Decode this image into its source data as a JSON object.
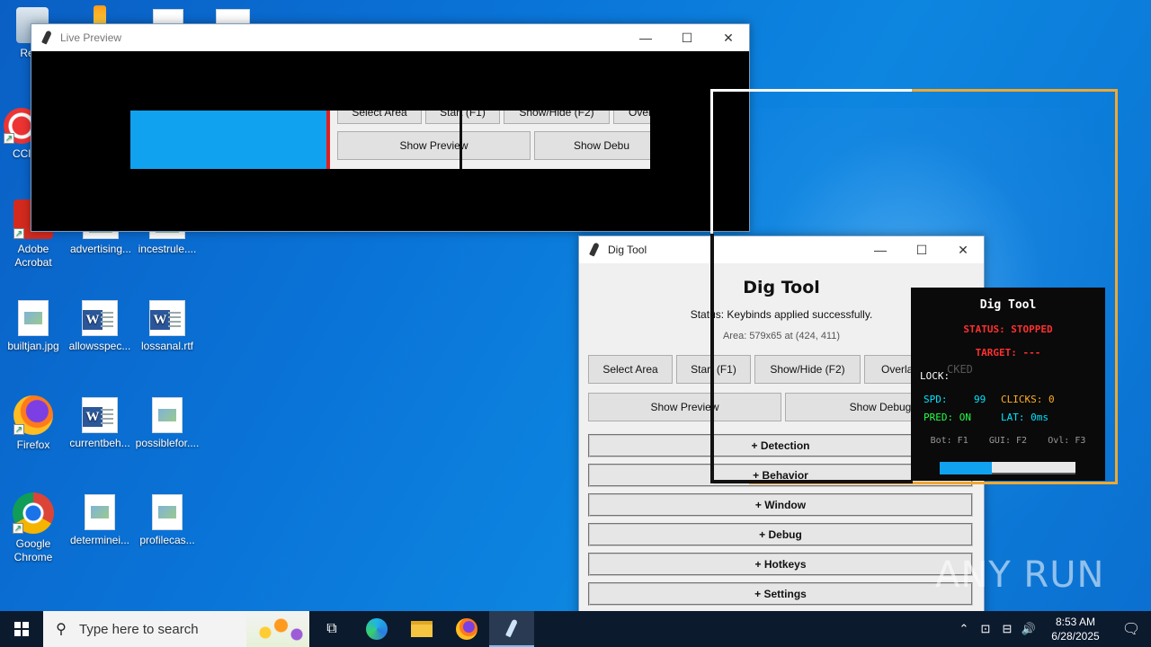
{
  "desktop": {
    "icons": [
      {
        "label": "Recy",
        "kind": "recycle"
      },
      {
        "label": "CCl",
        "kind": "ccleaner"
      },
      {
        "label": "Adobe Acrobat",
        "kind": "acrobat"
      },
      {
        "label": "advertising...",
        "kind": "doc"
      },
      {
        "label": "incestrule....",
        "kind": "doc"
      },
      {
        "label": "builtjan.jpg",
        "kind": "image"
      },
      {
        "label": "allowsspec...",
        "kind": "word"
      },
      {
        "label": "lossanal.rtf",
        "kind": "word"
      },
      {
        "label": "Firefox",
        "kind": "firefox"
      },
      {
        "label": "currentbeh...",
        "kind": "word"
      },
      {
        "label": "possiblefor....",
        "kind": "image"
      },
      {
        "label": "Google Chrome",
        "kind": "chrome"
      },
      {
        "label": "determinei...",
        "kind": "image"
      },
      {
        "label": "profilecas...",
        "kind": "image"
      }
    ]
  },
  "live_preview": {
    "title": "Live Preview",
    "buttons_row1": [
      "Select Area",
      "Start (F1)",
      "Show/Hide (F2)",
      "Over"
    ],
    "buttons_row2": [
      "Show Preview",
      "Show Debu"
    ]
  },
  "dig_tool": {
    "title": "Dig Tool",
    "heading": "Dig Tool",
    "status": "Status: Keybinds applied successfully.",
    "area": "Area: 579x65 at (424, 411)",
    "buttons_row1": [
      "Select Area",
      "Start (F1)",
      "Show/Hide (F2)",
      "Overla"
    ],
    "buttons_row2": [
      "Show Preview",
      "Show Debug"
    ],
    "sections": [
      "+ Detection",
      "+ Behavior",
      "+ Window",
      "+ Debug",
      "+ Hotkeys",
      "+ Settings"
    ]
  },
  "overlay": {
    "title": "Dig Tool",
    "status": "STATUS: STOPPED",
    "target": "TARGET: ---",
    "lock": "LOCK:",
    "spd_label": "SPD:",
    "spd_value": "99",
    "clicks": "CLICKS: 0",
    "pred": "PRED: ON",
    "lat": "LAT: 0ms",
    "keys": [
      "Bot: F1",
      "GUI: F2",
      "Ovl: F3"
    ],
    "behind_text": "CKED"
  },
  "taskbar": {
    "search_placeholder": "Type here to search",
    "time": "8:53 AM",
    "date": "6/28/2025"
  },
  "watermark": "ANY RUN"
}
